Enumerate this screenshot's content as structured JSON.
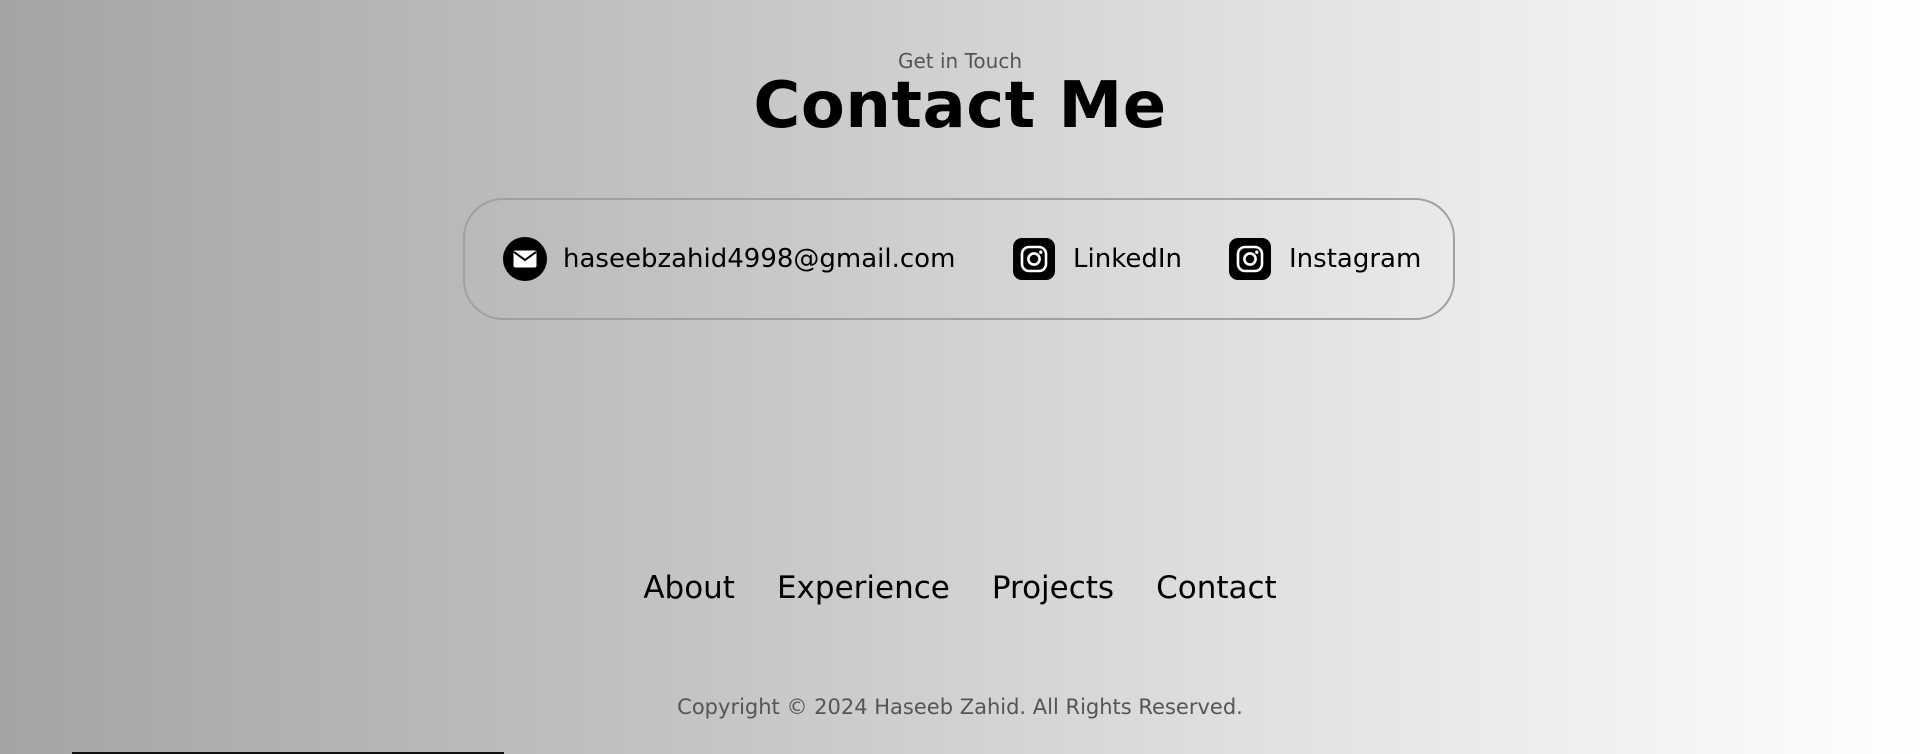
{
  "contact_section": {
    "subtitle": "Get in Touch",
    "title": "Contact Me",
    "items": [
      {
        "label": "haseebzahid4998@gmail.com",
        "icon": "email-icon"
      },
      {
        "label": "LinkedIn",
        "icon": "linkedin-icon"
      },
      {
        "label": "Instagram",
        "icon": "instagram-icon"
      }
    ]
  },
  "footer": {
    "nav": [
      "About",
      "Experience",
      "Projects",
      "Contact"
    ],
    "copyright": "Copyright © 2024 Haseeb Zahid. All Rights Reserved."
  },
  "colors": {
    "gradient_start": "#a4a4a4",
    "gradient_end": "#ffffff",
    "border": "#a0a0a0",
    "muted_text": "#555555",
    "text": "#000000"
  }
}
